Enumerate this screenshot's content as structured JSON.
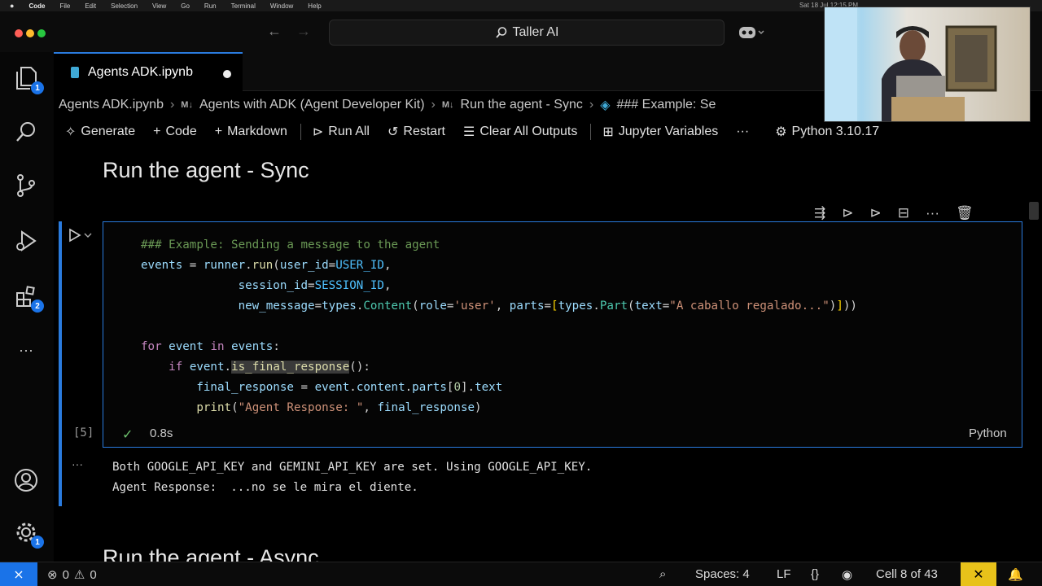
{
  "menubar": {
    "items": [
      "Code",
      "File",
      "Edit",
      "Selection",
      "View",
      "Go",
      "Run",
      "Terminal",
      "Window",
      "Help"
    ],
    "clock": "Sat 18 Jul 12:15 PM"
  },
  "titlebar": {
    "search_text": "Taller AI"
  },
  "tab": {
    "label": "Agents ADK.ipynb"
  },
  "breadcrumb": {
    "items": [
      {
        "label": "Agents ADK.ipynb",
        "prefix": ""
      },
      {
        "label": "Agents with ADK (Agent Developer Kit)",
        "prefix": "M↓"
      },
      {
        "label": "Run the agent - Sync",
        "prefix": "M↓"
      },
      {
        "label": "### Example: Se",
        "prefix": ""
      }
    ]
  },
  "toolbar": {
    "generate": "Generate",
    "code": "Code",
    "markdown": "Markdown",
    "run_all": "Run All",
    "restart": "Restart",
    "clear_outputs": "Clear All Outputs",
    "jupyter_vars": "Jupyter Variables",
    "more": "···",
    "kernel": "Python 3.10.17"
  },
  "activity": {
    "explorer_badge": "1",
    "extensions_badge": "2",
    "settings_badge": "1"
  },
  "notebook": {
    "heading": "Run the agent - Sync",
    "cell": {
      "exec_count": "[5]",
      "exec_time": "0.8s",
      "language": "Python",
      "output_lines": [
        "Both GOOGLE_API_KEY and GEMINI_API_KEY are set. Using GOOGLE_API_KEY.",
        "Agent Response:  ...no se le mira el diente."
      ]
    },
    "next_heading": "Run the agent - Async"
  },
  "statusbar": {
    "errors": "0",
    "warnings": "0",
    "spaces": "Spaces: 4",
    "eol": "LF",
    "braces": "{}",
    "cell_pos": "Cell 8 of 43"
  },
  "colors": {
    "accent": "#2a7bde",
    "badge": "#1a73e8",
    "pin": "#e8c21a"
  }
}
